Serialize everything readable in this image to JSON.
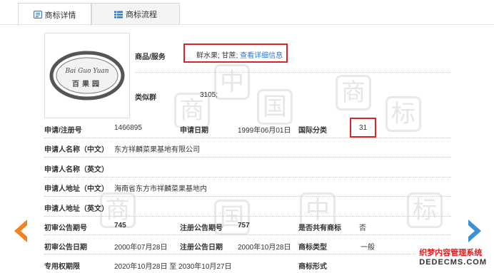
{
  "tabs": [
    {
      "label": "商标详情",
      "icon": "document-icon",
      "active": true
    },
    {
      "label": "商标流程",
      "icon": "list-icon",
      "active": false
    }
  ],
  "logo": {
    "text_latin": "Bai Guo Yuan",
    "text_cn": "百果园"
  },
  "goods_services": {
    "label": "商品/服务",
    "value": "鲜水果; 甘蔗;",
    "link": "查看详细信息"
  },
  "similar_group": {
    "label": "类似群",
    "value": "3105;"
  },
  "rows": {
    "reg_no_label": "申请/注册号",
    "reg_no": "1466895",
    "apply_date_label": "申请日期",
    "apply_date": "1999年06月01日",
    "intl_class_label": "国际分类",
    "intl_class": "31",
    "applicant_cn_label": "申请人名称（中文）",
    "applicant_cn": "东方祥麟菜果基地有限公司",
    "applicant_en_label": "申请人名称（英文）",
    "applicant_en": "",
    "address_cn_label": "申请人地址（中文）",
    "address_cn": "海南省东方市祥麟菜果基地内",
    "address_en_label": "申请人地址（英文）",
    "address_en": "",
    "prelim_no_label": "初审公告期号",
    "prelim_no": "745",
    "reg_pub_no_label": "注册公告期号",
    "reg_pub_no": "757",
    "shared_label": "是否共有商标",
    "shared": "否",
    "prelim_date_label": "初审公告日期",
    "prelim_date": "2000年07月28日",
    "reg_pub_date_label": "注册公告日期",
    "reg_pub_date": "2000年10月28日",
    "type_label": "商标类型",
    "type": "一般",
    "exclusive_label": "专用权期限",
    "exclusive": "2020年10月28日 至 2030年10月27日",
    "form_label": "商标形式",
    "form": ""
  },
  "watermark_chars": [
    "中",
    "国",
    "商",
    "标"
  ],
  "brand": {
    "line1": "织梦内容管理系统",
    "line2": "DEDECMS.COM"
  },
  "colors": {
    "accent": "#2a7ad3",
    "highlight": "#d9262b",
    "prev_arrow": "#f58220",
    "next_arrow": "#3d8fd6"
  }
}
